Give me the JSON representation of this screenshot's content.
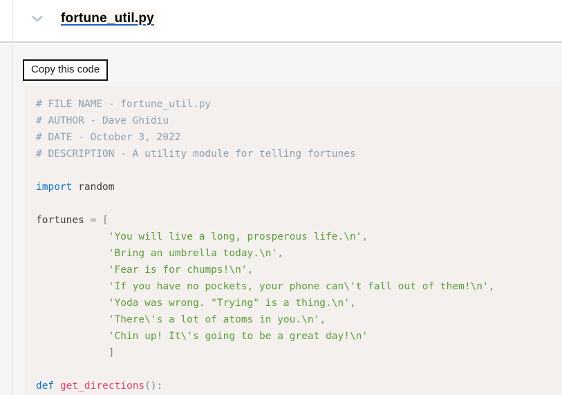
{
  "header": {
    "collapse_icon": "chevron-down-icon",
    "file_name": "fortune_util.py"
  },
  "toolbar": {
    "copy_label": "Copy this code"
  },
  "colors": {
    "comment": "#8f9eae",
    "keyword": "#0b72c4",
    "function": "#dd4477",
    "string": "#5a9c3a",
    "operator": "#9aa0a6",
    "plain": "#3f3f3f",
    "code_background": "#f4f0ed",
    "panel_background": "#f5f5f6",
    "title_underline": "#2060c0"
  },
  "code": {
    "language": "python",
    "lines": [
      [
        {
          "t": "comment",
          "s": "# FILE NAME - fortune_util.py"
        }
      ],
      [
        {
          "t": "comment",
          "s": "# AUTHOR - Dave Ghidiu"
        }
      ],
      [
        {
          "t": "comment",
          "s": "# DATE - October 3, 2022"
        }
      ],
      [
        {
          "t": "comment",
          "s": "# DESCRIPTION - A utility module for telling fortunes"
        }
      ],
      [
        {
          "t": "plain",
          "s": ""
        }
      ],
      [
        {
          "t": "keyword",
          "s": "import"
        },
        {
          "t": "plain",
          "s": " "
        },
        {
          "t": "name",
          "s": "random"
        }
      ],
      [
        {
          "t": "plain",
          "s": ""
        }
      ],
      [
        {
          "t": "name",
          "s": "fortunes"
        },
        {
          "t": "plain",
          "s": " "
        },
        {
          "t": "op",
          "s": "="
        },
        {
          "t": "plain",
          "s": " "
        },
        {
          "t": "punct",
          "s": "["
        }
      ],
      [
        {
          "t": "plain",
          "s": "            "
        },
        {
          "t": "string",
          "s": "'You will live a long, prosperous life.\\n'"
        },
        {
          "t": "punct",
          "s": ","
        }
      ],
      [
        {
          "t": "plain",
          "s": "            "
        },
        {
          "t": "string",
          "s": "'Bring an umbrella today.\\n'"
        },
        {
          "t": "punct",
          "s": ","
        }
      ],
      [
        {
          "t": "plain",
          "s": "            "
        },
        {
          "t": "string",
          "s": "'Fear is for chumps!\\n'"
        },
        {
          "t": "punct",
          "s": ","
        }
      ],
      [
        {
          "t": "plain",
          "s": "            "
        },
        {
          "t": "string",
          "s": "'If you have no pockets, your phone can\\'t fall out of them!\\n'"
        },
        {
          "t": "punct",
          "s": ","
        }
      ],
      [
        {
          "t": "plain",
          "s": "            "
        },
        {
          "t": "string",
          "s": "'Yoda was wrong. \"Trying\" is a thing.\\n'"
        },
        {
          "t": "punct",
          "s": ","
        }
      ],
      [
        {
          "t": "plain",
          "s": "            "
        },
        {
          "t": "string",
          "s": "'There\\'s a lot of atoms in you.\\n'"
        },
        {
          "t": "punct",
          "s": ","
        }
      ],
      [
        {
          "t": "plain",
          "s": "            "
        },
        {
          "t": "string",
          "s": "'Chin up! It\\'s going to be a great day!\\n'"
        }
      ],
      [
        {
          "t": "plain",
          "s": "            "
        },
        {
          "t": "punct",
          "s": "]"
        }
      ],
      [
        {
          "t": "plain",
          "s": ""
        }
      ],
      [
        {
          "t": "keyword",
          "s": "def"
        },
        {
          "t": "plain",
          "s": " "
        },
        {
          "t": "func",
          "s": "get_directions"
        },
        {
          "t": "punct",
          "s": "():"
        }
      ]
    ]
  }
}
